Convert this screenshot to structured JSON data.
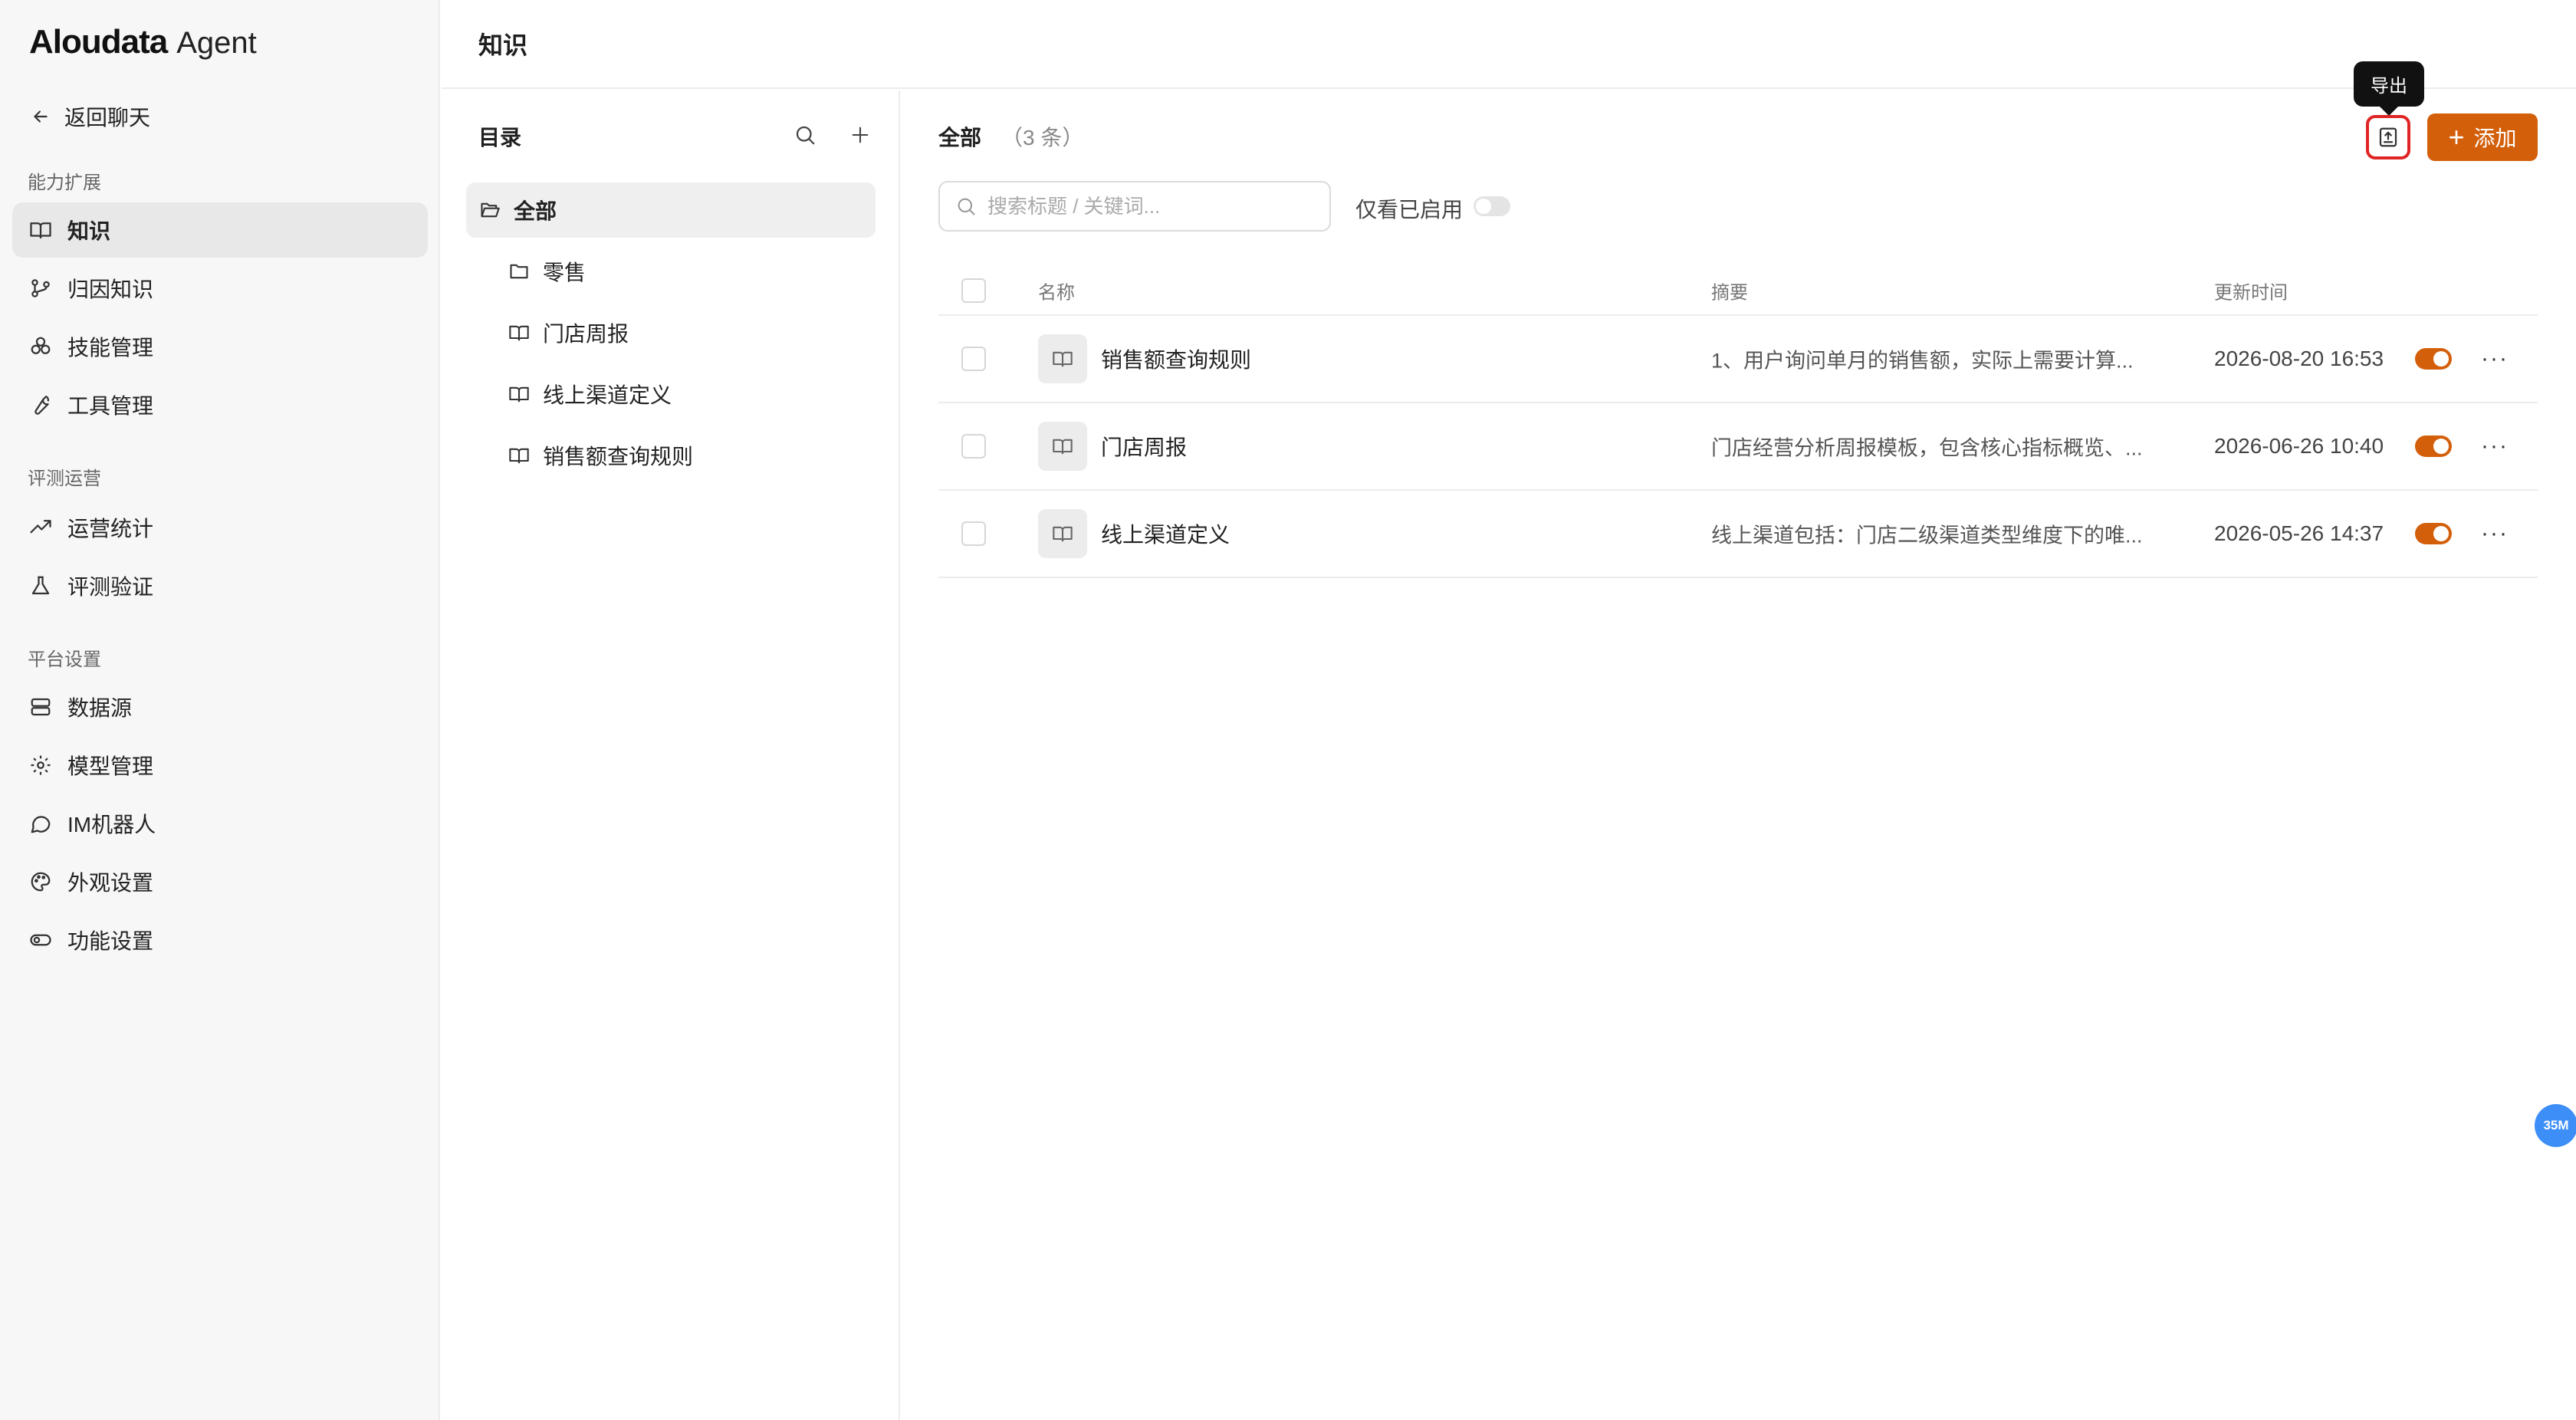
{
  "brand": {
    "name": "Aloudata",
    "suffix": "Agent"
  },
  "back_label": "返回聊天",
  "sidebar": {
    "sections": [
      {
        "label": "能力扩展",
        "items": [
          {
            "label": "知识",
            "icon": "book-icon",
            "active": true
          },
          {
            "label": "归因知识",
            "icon": "branch-icon"
          },
          {
            "label": "技能管理",
            "icon": "cubes-icon"
          },
          {
            "label": "工具管理",
            "icon": "wrench-icon"
          }
        ]
      },
      {
        "label": "评测运营",
        "items": [
          {
            "label": "运营统计",
            "icon": "trend-icon"
          },
          {
            "label": "评测验证",
            "icon": "flask-icon"
          }
        ]
      },
      {
        "label": "平台设置",
        "items": [
          {
            "label": "数据源",
            "icon": "database-icon"
          },
          {
            "label": "模型管理",
            "icon": "gear-icon"
          },
          {
            "label": "IM机器人",
            "icon": "chat-icon"
          },
          {
            "label": "外观设置",
            "icon": "palette-icon"
          },
          {
            "label": "功能设置",
            "icon": "toggle-icon"
          }
        ]
      }
    ]
  },
  "header": {
    "title": "知识"
  },
  "catalog": {
    "title": "目录",
    "items": [
      {
        "label": "全部",
        "icon": "folder-open-icon",
        "active": true
      },
      {
        "label": "零售",
        "icon": "folder-icon"
      },
      {
        "label": "门店周报",
        "icon": "book-icon"
      },
      {
        "label": "线上渠道定义",
        "icon": "book-icon"
      },
      {
        "label": "销售额查询规则",
        "icon": "book-icon"
      }
    ]
  },
  "main": {
    "title": "全部",
    "count": "（3 条）",
    "export_tooltip": "导出",
    "add_label": "添加",
    "search_placeholder": "搜索标题 / 关键词...",
    "only_enabled_label": "仅看已启用",
    "columns": {
      "name": "名称",
      "summary": "摘要",
      "updated": "更新时间"
    },
    "rows": [
      {
        "name": "销售额查询规则",
        "summary": "1、用户询问单月的销售额，实际上需要计算...",
        "updated": "2026-08-20 16:53",
        "enabled": true
      },
      {
        "name": "门店周报",
        "summary": "门店经营分析周报模板，包含核心指标概览、...",
        "updated": "2026-06-26 10:40",
        "enabled": true
      },
      {
        "name": "线上渠道定义",
        "summary": "线上渠道包括：门店二级渠道类型维度下的唯...",
        "updated": "2026-05-26 14:37",
        "enabled": true
      }
    ]
  },
  "memory_badge": "35M",
  "colors": {
    "accent": "#d35f0b",
    "highlight": "#e02424",
    "badge": "#3d8ef7"
  }
}
